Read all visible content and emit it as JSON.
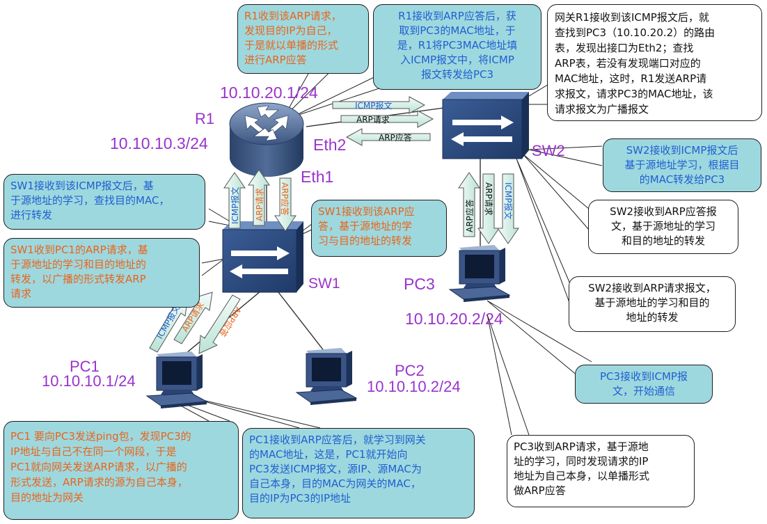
{
  "devices": {
    "r1": {
      "name": "R1",
      "ip_upper": "10.10.20.1/24",
      "ip_lower": "10.10.10.3/24",
      "eth1": "Eth1",
      "eth2": "Eth2"
    },
    "sw1": {
      "name": "SW1"
    },
    "sw2": {
      "name": "SW2"
    },
    "pc1": {
      "name": "PC1",
      "ip": "10.10.10.1/24"
    },
    "pc2": {
      "name": "PC2",
      "ip": "10.10.10.2/24"
    },
    "pc3": {
      "name": "PC3",
      "ip": "10.10.20.2/24"
    }
  },
  "arrows": {
    "r1_sw2_icmp": "ICMP报文",
    "r1_sw2_arp_req": "ARP请求",
    "r1_sw2_arp_reply": "ARP应答",
    "sw1_r1_icmp": "ICMP报文",
    "sw1_r1_arp_req": "ARP请求",
    "sw1_r1_arp_reply": "ARP应答",
    "pc1_sw1_icmp": "ICMP报文",
    "pc1_sw1_arp_req": "ARP请求",
    "pc1_sw1_arp_reply": "ARP应答",
    "sw2_pc3_arp_reply": "ARP应答",
    "sw2_pc3_arp_req": "ARP请求",
    "sw2_pc3_icmp": "ICMP报文"
  },
  "notes": {
    "r1_arp_request": "R1收到该ARP请求，\n发现目的IP为自己，\n于是就以单播的形式\n进行ARP应答",
    "r1_arp_reply": "R1接收到ARP应答后，获\n取到PC3的MAC地址，于\n是，R1将PC3MAC地址填\n入ICMP报文中，将ICMP\n报文转发给PC3",
    "gateway": "网关R1接收到该ICMP报文后，就\n查找到PC3（10.10.20.2）的路由\n表，发现出接口为Eth2；查找\nARP表，若没有发现端口对应的\nMAC地址，这时，R1发送ARP请\n求报文，请求PC3的MAC地址，该\n请求报文为广播报文",
    "sw2_icmp": "SW2接收到ICMP报文后\n基于源地址学习，根据目\n的MAC转发给PC3",
    "sw2_arp_reply": "SW2接收到ARP应答报\n文，基于源地址的学习\n和目的地址的转发",
    "sw2_arp_request": "SW2接收到ARP请求报文，\n基于源地址的学习和目的\n地址的转发",
    "pc3_icmp": "PC3接收到ICMP报\n文，开始通信",
    "pc3_arp": "PC3收到ARP请求，基于源地\n址的学习，同时发现请求的IP\n地址为自己本身，以单播形式\n做ARP应答",
    "sw1_icmp": "SW1接收到该ICMP报文后，基\n于源地址的学习，查找目的MAC，\n进行转发",
    "sw1_arp_reply": "SW1接收到该ARP应\n答，基于源地址的学\n习与目的地址的转发",
    "sw1_arp_request": "SW1收到PC1的ARP请求，基\n于源地址的学习和目的地址的\n转发，以广播的形式转发ARP\n请求",
    "pc1_ping": "PC1 要向PC3发送ping包，发现PC3的\nIP地址与自己不在同一个网段，于是\nPC1就向网关发送ARP请求，以广播的\n形式发送，ARP请求的源为自己本身，\n目的地址为网关",
    "pc1_arp_reply": "PC1接收到ARP应答后，就学习到网关\n的MAC地址，这是，PC1就开始向\nPC3发送ICMP报文，源IP、源MAC为\n自己本身，目的MAC为网关的MAC，\n目的IP为PC3的IP地址"
  },
  "colors": {
    "teal_note": "#9ed8df",
    "orange_text": "#e8641a",
    "blue_text": "#1f5fd0",
    "purple_label": "#9933cc",
    "switch_blue": "#2e4f86",
    "router_blue": "#46628f"
  }
}
